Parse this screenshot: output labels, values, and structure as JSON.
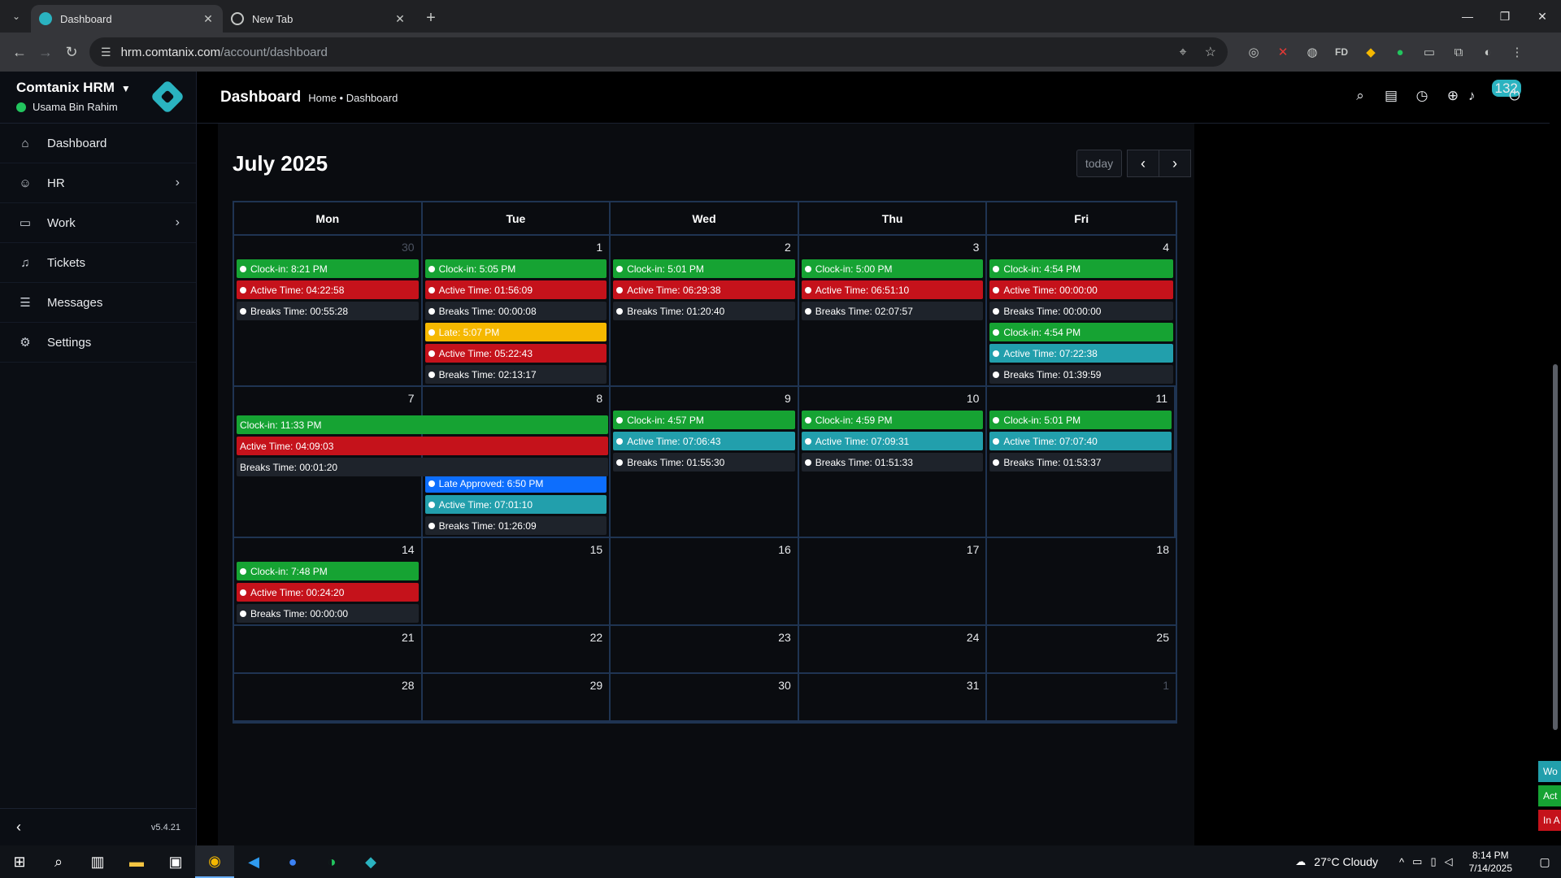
{
  "browser": {
    "tabs": [
      {
        "title": "Dashboard",
        "active": true
      },
      {
        "title": "New Tab",
        "active": false
      }
    ],
    "url_host": "hrm.comtanix.com",
    "url_path": "/account/dashboard"
  },
  "sidebar": {
    "company": "Comtanix HRM",
    "user": "Usama Bin Rahim",
    "items": [
      {
        "label": "Dashboard",
        "icon": "home-icon",
        "has_arrow": false
      },
      {
        "label": "HR",
        "icon": "users-icon",
        "has_arrow": true
      },
      {
        "label": "Work",
        "icon": "briefcase-icon",
        "has_arrow": true
      },
      {
        "label": "Tickets",
        "icon": "headset-icon",
        "has_arrow": false
      },
      {
        "label": "Messages",
        "icon": "chat-icon",
        "has_arrow": false
      },
      {
        "label": "Settings",
        "icon": "gear-icon",
        "has_arrow": false
      }
    ],
    "version": "v5.4.21"
  },
  "header": {
    "title": "Dashboard",
    "breadcrumb": "Home • Dashboard",
    "notification_count": "132"
  },
  "calendar": {
    "month": "July 2025",
    "today_label": "today",
    "weekdays": [
      "Mon",
      "Tue",
      "Wed",
      "Thu",
      "Fri"
    ],
    "weeks": [
      {
        "days": [
          {
            "num": "30",
            "other": true,
            "events": [
              {
                "text": "Clock-in: 8:21 PM",
                "color": "green"
              },
              {
                "text": "Active Time: 04:22:58",
                "color": "red"
              },
              {
                "text": "Breaks Time: 00:55:28",
                "color": "gray"
              }
            ]
          },
          {
            "num": "1",
            "events": [
              {
                "text": "Clock-in: 5:05 PM",
                "color": "green"
              },
              {
                "text": "Active Time: 01:56:09",
                "color": "red"
              },
              {
                "text": "Breaks Time: 00:00:08",
                "color": "gray"
              },
              {
                "text": "Late: 5:07 PM",
                "color": "yellow"
              },
              {
                "text": "Active Time: 05:22:43",
                "color": "red"
              },
              {
                "text": "Breaks Time: 02:13:17",
                "color": "gray"
              }
            ]
          },
          {
            "num": "2",
            "events": [
              {
                "text": "Clock-in: 5:01 PM",
                "color": "green"
              },
              {
                "text": "Active Time: 06:29:38",
                "color": "red"
              },
              {
                "text": "Breaks Time: 01:20:40",
                "color": "gray"
              }
            ]
          },
          {
            "num": "3",
            "events": [
              {
                "text": "Clock-in: 5:00 PM",
                "color": "green"
              },
              {
                "text": "Active Time: 06:51:10",
                "color": "red"
              },
              {
                "text": "Breaks Time: 02:07:57",
                "color": "gray"
              }
            ]
          },
          {
            "num": "4",
            "events": [
              {
                "text": "Clock-in: 4:54 PM",
                "color": "green"
              },
              {
                "text": "Active Time: 00:00:00",
                "color": "red"
              },
              {
                "text": "Breaks Time: 00:00:00",
                "color": "gray"
              },
              {
                "text": "Clock-in: 4:54 PM",
                "color": "green"
              },
              {
                "text": "Active Time: 07:22:38",
                "color": "teal"
              },
              {
                "text": "Breaks Time: 01:39:59",
                "color": "gray"
              }
            ]
          }
        ]
      },
      {
        "spanning": [
          {
            "text": "Clock-in: 11:33 PM",
            "color": "green"
          },
          {
            "text": "Active Time: 04:09:03",
            "color": "red"
          },
          {
            "text": "Breaks Time: 00:01:20",
            "color": "gray"
          }
        ],
        "days": [
          {
            "num": "7",
            "events": []
          },
          {
            "num": "8",
            "events": [
              {
                "text": "Late Approved: 6:50 PM",
                "color": "blue"
              },
              {
                "text": "Active Time: 07:01:10",
                "color": "teal"
              },
              {
                "text": "Breaks Time: 01:26:09",
                "color": "gray"
              }
            ]
          },
          {
            "num": "9",
            "events": [
              {
                "text": "Clock-in: 4:57 PM",
                "color": "green"
              },
              {
                "text": "Active Time: 07:06:43",
                "color": "teal"
              },
              {
                "text": "Breaks Time: 01:55:30",
                "color": "gray"
              }
            ]
          },
          {
            "num": "10",
            "events": [
              {
                "text": "Clock-in: 4:59 PM",
                "color": "green"
              },
              {
                "text": "Active Time: 07:09:31",
                "color": "teal"
              },
              {
                "text": "Breaks Time: 01:51:33",
                "color": "gray"
              }
            ]
          },
          {
            "num": "11",
            "events": [
              {
                "text": "Clock-in: 5:01 PM",
                "color": "green"
              },
              {
                "text": "Active Time: 07:07:40",
                "color": "teal"
              },
              {
                "text": "Breaks Time: 01:53:37",
                "color": "gray"
              }
            ]
          }
        ]
      },
      {
        "days": [
          {
            "num": "14",
            "events": [
              {
                "text": "Clock-in: 7:48 PM",
                "color": "green"
              },
              {
                "text": "Active Time: 00:24:20",
                "color": "red"
              },
              {
                "text": "Breaks Time: 00:00:00",
                "color": "gray"
              }
            ]
          },
          {
            "num": "15",
            "events": []
          },
          {
            "num": "16",
            "events": []
          },
          {
            "num": "17",
            "events": []
          },
          {
            "num": "18",
            "events": []
          }
        ]
      },
      {
        "days": [
          {
            "num": "21",
            "events": []
          },
          {
            "num": "22",
            "events": []
          },
          {
            "num": "23",
            "events": []
          },
          {
            "num": "24",
            "events": []
          },
          {
            "num": "25",
            "events": []
          }
        ]
      },
      {
        "days": [
          {
            "num": "28",
            "events": []
          },
          {
            "num": "29",
            "events": []
          },
          {
            "num": "30",
            "events": []
          },
          {
            "num": "31",
            "events": []
          },
          {
            "num": "1",
            "other": true,
            "events": []
          }
        ]
      }
    ]
  },
  "side_tabs": [
    {
      "text": "Wo",
      "color": "#229fac"
    },
    {
      "text": "Act",
      "color": "#16a333"
    },
    {
      "text": "In A",
      "color": "#c5121b"
    }
  ],
  "taskbar": {
    "weather": "27°C  Cloudy",
    "time": "8:14 PM",
    "date": "7/14/2025"
  }
}
